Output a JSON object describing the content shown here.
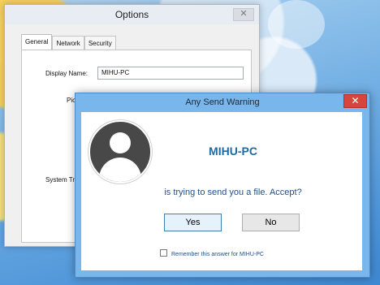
{
  "options_window": {
    "title": "Options",
    "close_glyph": "✕",
    "tabs": [
      {
        "label": "General"
      },
      {
        "label": "Network"
      },
      {
        "label": "Security"
      }
    ],
    "display_name_label": "Display Name:",
    "display_name_value": "MIHU-PC",
    "picture_label_partial": "Pictu",
    "system_tray_label_partial": "System Tr"
  },
  "warning_dialog": {
    "title": "Any Send Warning",
    "close_glyph": "✕",
    "pc_name": "MIHU-PC",
    "prompt": "is trying to send you a file. Accept?",
    "yes_label": "Yes",
    "no_label": "No",
    "remember_label": "Remember this answer for MIHU-PC"
  }
}
